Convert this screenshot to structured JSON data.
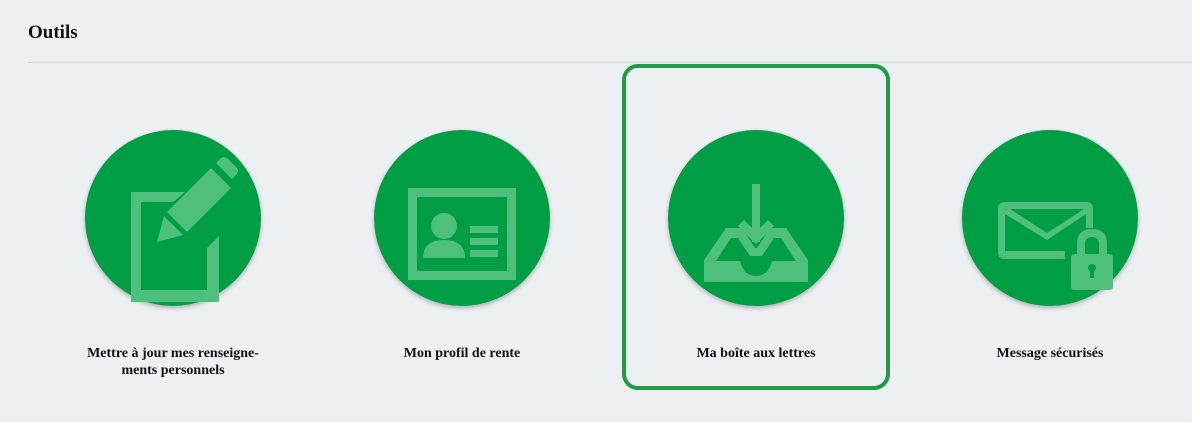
{
  "section": {
    "title": "Outils"
  },
  "tools": [
    {
      "label_line1": "Mettre à jour mes renseigne-",
      "label_line2": "ments personnels",
      "icon": "edit-document-icon"
    },
    {
      "label_line1": "Mon profil de rente",
      "label_line2": "",
      "icon": "id-card-icon"
    },
    {
      "label_line1": "Ma boîte aux lettres",
      "label_line2": "",
      "icon": "inbox-download-icon",
      "selected": true
    },
    {
      "label_line1": "Message sécurisés",
      "label_line2": "",
      "icon": "secure-mail-icon"
    }
  ],
  "colors": {
    "accent": "#009e44",
    "selection_border": "#1f9b48",
    "background": "#edf0f3"
  }
}
